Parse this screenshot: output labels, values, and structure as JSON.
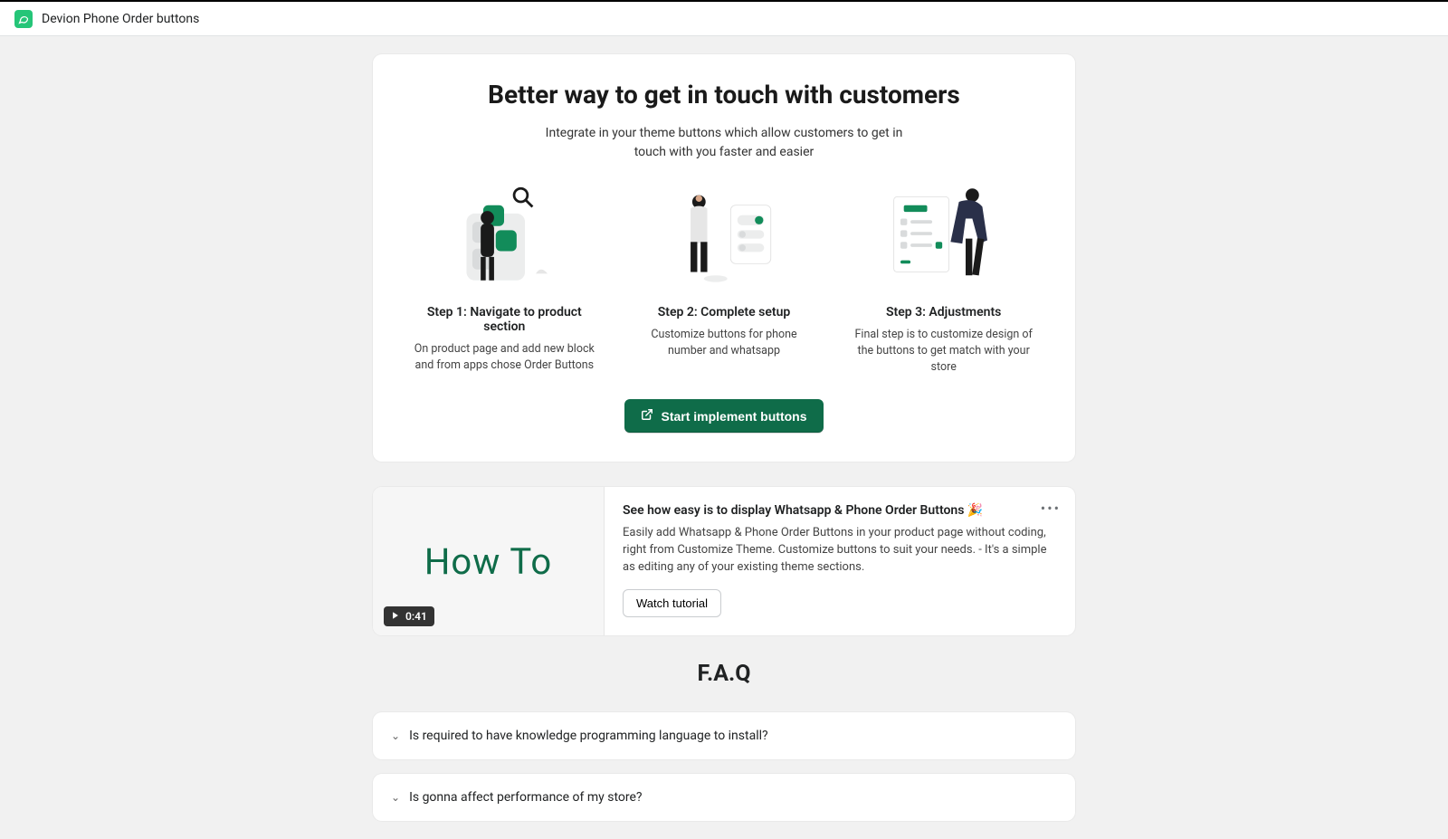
{
  "app": {
    "title": "Devion Phone Order buttons"
  },
  "hero": {
    "title": "Better way to get in touch with customers",
    "subtitle": "Integrate in your theme buttons which allow customers to get in touch with you faster and easier",
    "cta_label": "Start implement buttons"
  },
  "steps": [
    {
      "title": "Step 1: Navigate to product section",
      "desc": "On product page and add new block and from apps chose Order Buttons"
    },
    {
      "title": "Step 2: Complete setup",
      "desc": "Customize buttons for phone number and whatsapp"
    },
    {
      "title": "Step 3: Adjustments",
      "desc": "Final step is to customize design of the buttons to get match with your store"
    }
  ],
  "howto": {
    "graphic_label": "How To",
    "duration": "0:41",
    "title": "See how easy is to display Whatsapp & Phone Order Buttons 🎉",
    "desc": "Easily add Whatsapp & Phone Order Buttons in your product page without coding, right from Customize Theme. Customize buttons to suit your needs. - It's a simple as editing any of your existing theme sections.",
    "watch_label": "Watch tutorial"
  },
  "faq": {
    "title": "F.A.Q",
    "items": [
      "Is required to have knowledge programming language to install?",
      "Is gonna affect performance of my store?"
    ]
  }
}
